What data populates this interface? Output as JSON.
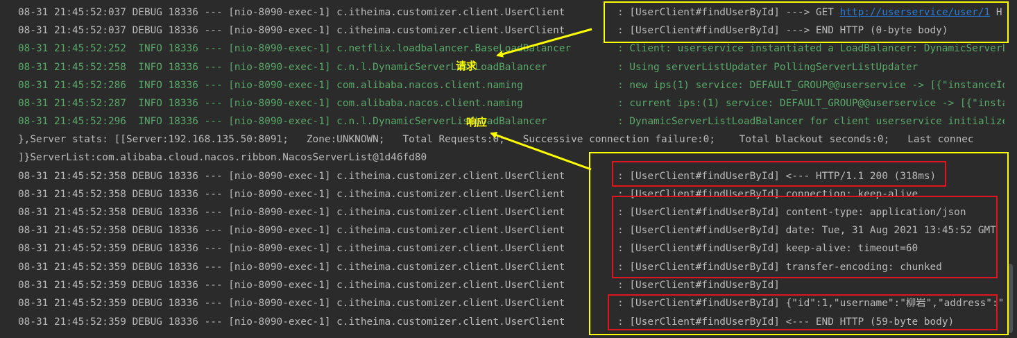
{
  "lines": [
    {
      "level": "debug",
      "prefix": "08-31 21:45:52:037 DEBUG 18336 --- [nio-8090-exec-1] c.itheima.customizer.client.UserClient",
      "msg": ": [UserClient#findUserById] ---> GET ",
      "link": "http://userservice/user/1",
      "after": " H"
    },
    {
      "level": "debug",
      "prefix": "08-31 21:45:52:037 DEBUG 18336 --- [nio-8090-exec-1] c.itheima.customizer.client.UserClient",
      "msg": ": [UserClient#findUserById] ---> END HTTP (0-byte body)"
    },
    {
      "level": "info",
      "prefix": "08-31 21:45:52:252  INFO 18336 --- [nio-8090-exec-1] c.netflix.loadbalancer.BaseLoadBalancer",
      "msg": ": Client: userservice instantiated a LoadBalancer: DynamicServerL"
    },
    {
      "level": "info",
      "prefix": "08-31 21:45:52:258  INFO 18336 --- [nio-8090-exec-1] c.n.l.DynamicServerListLoadBalancer",
      "msg": ": Using serverListUpdater PollingServerListUpdater"
    },
    {
      "level": "info",
      "prefix": "08-31 21:45:52:286  INFO 18336 --- [nio-8090-exec-1] com.alibaba.nacos.client.naming",
      "msg": ": new ips(1) service: DEFAULT_GROUP@@userservice -> [{\"instanceId"
    },
    {
      "level": "info",
      "prefix": "08-31 21:45:52:287  INFO 18336 --- [nio-8090-exec-1] com.alibaba.nacos.client.naming",
      "msg": ": current ips:(1) service: DEFAULT_GROUP@@userservice -> [{\"insta"
    },
    {
      "level": "info",
      "prefix": "08-31 21:45:52:296  INFO 18336 --- [nio-8090-exec-1] c.n.l.DynamicServerListLoadBalancer",
      "msg": ": DynamicServerListLoadBalancer for client userservice initialize"
    },
    {
      "level": "plain",
      "prefix": "},Server stats: [[Server:192.168.135.50:8091;   Zone:UNKNOWN;   Total Requests:0;   Successive connection failure:0;    Total blackout seconds:0;   Last connec",
      "msg": ""
    },
    {
      "level": "plain",
      "prefix": "]}ServerList:com.alibaba.cloud.nacos.ribbon.NacosServerList@1d46fd80",
      "msg": ""
    },
    {
      "level": "debug",
      "prefix": "08-31 21:45:52:358 DEBUG 18336 --- [nio-8090-exec-1] c.itheima.customizer.client.UserClient",
      "msg": ": [UserClient#findUserById] <--- HTTP/1.1 200 (318ms)"
    },
    {
      "level": "debug",
      "prefix": "08-31 21:45:52:358 DEBUG 18336 --- [nio-8090-exec-1] c.itheima.customizer.client.UserClient",
      "msg": ": [UserClient#findUserById] connection: keep-alive"
    },
    {
      "level": "debug",
      "prefix": "08-31 21:45:52:358 DEBUG 18336 --- [nio-8090-exec-1] c.itheima.customizer.client.UserClient",
      "msg": ": [UserClient#findUserById] content-type: application/json"
    },
    {
      "level": "debug",
      "prefix": "08-31 21:45:52:358 DEBUG 18336 --- [nio-8090-exec-1] c.itheima.customizer.client.UserClient",
      "msg": ": [UserClient#findUserById] date: Tue, 31 Aug 2021 13:45:52 GMT"
    },
    {
      "level": "debug",
      "prefix": "08-31 21:45:52:359 DEBUG 18336 --- [nio-8090-exec-1] c.itheima.customizer.client.UserClient",
      "msg": ": [UserClient#findUserById] keep-alive: timeout=60"
    },
    {
      "level": "debug",
      "prefix": "08-31 21:45:52:359 DEBUG 18336 --- [nio-8090-exec-1] c.itheima.customizer.client.UserClient",
      "msg": ": [UserClient#findUserById] transfer-encoding: chunked"
    },
    {
      "level": "debug",
      "prefix": "08-31 21:45:52:359 DEBUG 18336 --- [nio-8090-exec-1] c.itheima.customizer.client.UserClient",
      "msg": ": [UserClient#findUserById]"
    },
    {
      "level": "debug",
      "prefix": "08-31 21:45:52:359 DEBUG 18336 --- [nio-8090-exec-1] c.itheima.customizer.client.UserClient",
      "msg": ": [UserClient#findUserById] {\"id\":1,\"username\":\"柳岩\",\"address\":\""
    },
    {
      "level": "debug",
      "prefix": "08-31 21:45:52:359 DEBUG 18336 --- [nio-8090-exec-1] c.itheima.customizer.client.UserClient",
      "msg": ": [UserClient#findUserById] <--- END HTTP (59-byte body)"
    }
  ],
  "annotations": {
    "request_label": "请求",
    "response_label": "响应"
  },
  "colors": {
    "highlight_yellow": "#ffff00",
    "highlight_red": "#e0161e",
    "info_green": "#59a869",
    "debug_gray": "#bbbbbb",
    "background": "#2b2b2b"
  }
}
